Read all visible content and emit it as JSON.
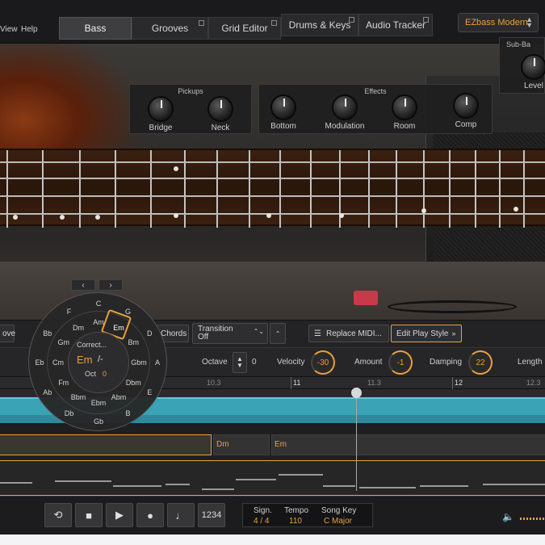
{
  "menu": {
    "view": "View",
    "help": "Help"
  },
  "tabs": [
    {
      "label": "Bass"
    },
    {
      "label": "Grooves"
    },
    {
      "label": "Grid Editor"
    },
    {
      "label": "Drums & Keys"
    },
    {
      "label": "Audio Tracker"
    }
  ],
  "preset": {
    "label": "EZbass Modern"
  },
  "panels": {
    "pickups": {
      "title": "Pickups",
      "knobs": [
        "Bridge",
        "Neck"
      ]
    },
    "effects": {
      "title": "Effects",
      "knobs": [
        "Bottom",
        "Modulation",
        "Room",
        "Comp"
      ]
    },
    "subbass": {
      "title": "Sub-Ba",
      "knobs": [
        "Level"
      ]
    }
  },
  "controls": {
    "move_label": "ove",
    "chords_label": "Chords",
    "transition_label": "Transition",
    "transition_value": "Off",
    "replace_midi_label": "Replace MIDI...",
    "edit_play_style_label": "Edit Play Style",
    "octave_label": "Octave",
    "octave_value": "0",
    "velocity_label": "Velocity",
    "velocity_value": "-30",
    "amount_label": "Amount",
    "amount_value": "-1",
    "damping_label": "Damping",
    "damping_value": "22",
    "length_label": "Length"
  },
  "ruler": {
    "m10_3": "10.3",
    "m11": "11",
    "m11_3": "11.3",
    "m12": "12",
    "m12_3": "12.3"
  },
  "chord_blocks": [
    {
      "label": ""
    },
    {
      "label": "Dm"
    },
    {
      "label": "Em"
    }
  ],
  "chord_wheel": {
    "outer": [
      "C",
      "G",
      "D",
      "A",
      "E",
      "B",
      "Gb",
      "Db",
      "Ab",
      "Eb",
      "Bb",
      "F"
    ],
    "inner": [
      "Am",
      "Em",
      "Bm",
      "Gbm",
      "Dbm",
      "Abm",
      "Ebm",
      "Bbm",
      "Fm",
      "Cm",
      "Gm",
      "Dm"
    ],
    "center_hint": "Correct...",
    "center_chord": "Em",
    "center_slash": "/-",
    "octave_label": "Oct",
    "octave_value": "0",
    "selected": "Em"
  },
  "transport": {
    "loop_icon": "loop-icon",
    "stop_icon": "stop-icon",
    "play_icon": "play-icon",
    "record_icon": "record-icon",
    "metronome_icon": "metronome-icon",
    "count_in": "1234",
    "sign_label": "Sign.",
    "sign_value": "4 / 4",
    "tempo_label": "Tempo",
    "tempo_value": "110",
    "key_label": "Song Key",
    "key_value": "C Major"
  },
  "colors": {
    "accent": "#e8a13a",
    "teal": "#3aa3b6",
    "bg": "#1d1d1f"
  }
}
